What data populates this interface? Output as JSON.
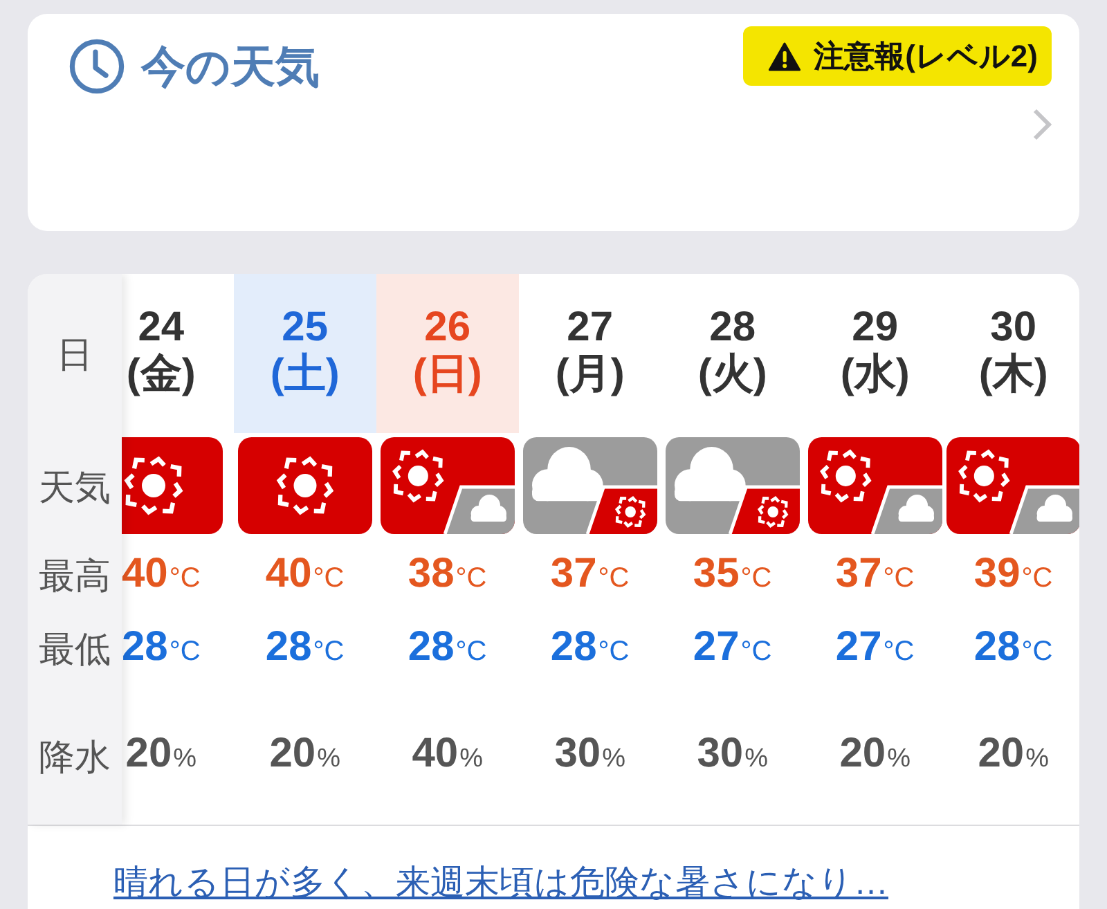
{
  "current_weather": {
    "title": "今の天気",
    "alert_badge": "注意報(レベル2)"
  },
  "forecast": {
    "row_labels": [
      {
        "kind": "date",
        "label": "日"
      },
      {
        "kind": "weather",
        "label": "天気"
      },
      {
        "kind": "high",
        "label": "最高"
      },
      {
        "kind": "low",
        "label": "最低"
      },
      {
        "kind": "precip",
        "label": "降水"
      }
    ],
    "days": [
      {
        "kind": "weekday",
        "date": "24",
        "weekday": "(金)",
        "weather_icon": {
          "kind": "sunny"
        },
        "high": "40",
        "high_unit": "°C",
        "low": "28",
        "low_unit": "°C",
        "precip": "20",
        "precip_unit": "%"
      },
      {
        "kind": "saturday",
        "date": "25",
        "weekday": "(土)",
        "weather_icon": {
          "kind": "sunny"
        },
        "high": "40",
        "high_unit": "°C",
        "low": "28",
        "low_unit": "°C",
        "precip": "20",
        "precip_unit": "%"
      },
      {
        "kind": "sunday",
        "date": "26",
        "weekday": "(日)",
        "weather_icon": {
          "kind": "suncloud"
        },
        "high": "38",
        "high_unit": "°C",
        "low": "28",
        "low_unit": "°C",
        "precip": "40",
        "precip_unit": "%"
      },
      {
        "kind": "weekday",
        "date": "27",
        "weekday": "(月)",
        "weather_icon": {
          "kind": "cloudsun"
        },
        "high": "37",
        "high_unit": "°C",
        "low": "28",
        "low_unit": "°C",
        "precip": "30",
        "precip_unit": "%"
      },
      {
        "kind": "weekday",
        "date": "28",
        "weekday": "(火)",
        "weather_icon": {
          "kind": "cloudsun"
        },
        "high": "35",
        "high_unit": "°C",
        "low": "27",
        "low_unit": "°C",
        "precip": "30",
        "precip_unit": "%"
      },
      {
        "kind": "weekday",
        "date": "29",
        "weekday": "(水)",
        "weather_icon": {
          "kind": "suncloud"
        },
        "high": "37",
        "high_unit": "°C",
        "low": "27",
        "low_unit": "°C",
        "precip": "20",
        "precip_unit": "%"
      },
      {
        "kind": "weekday",
        "date": "30",
        "weekday": "(木)",
        "weather_icon": {
          "kind": "suncloud"
        },
        "high": "39",
        "high_unit": "°C",
        "low": "28",
        "low_unit": "°C",
        "precip": "20",
        "precip_unit": "%"
      }
    ],
    "summary_link": "晴れる日が多く、来週末頃は危険な暑さになり…"
  }
}
